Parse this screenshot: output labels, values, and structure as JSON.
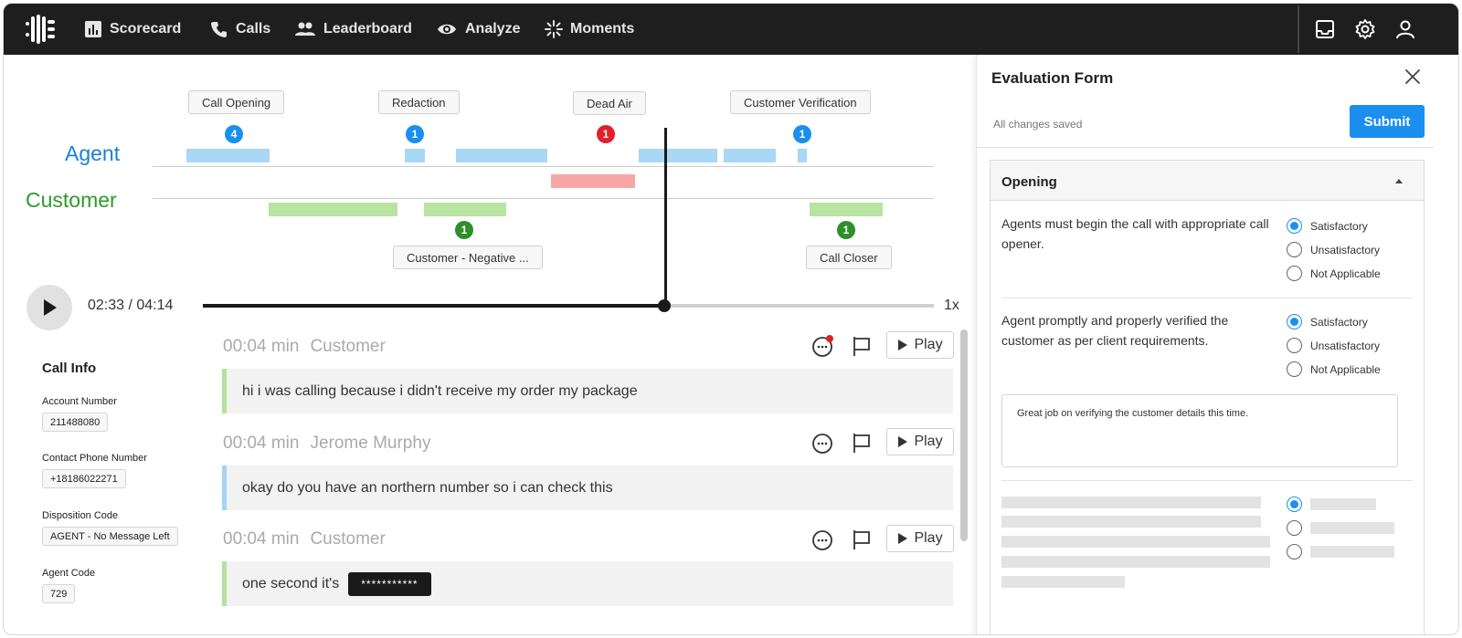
{
  "nav": {
    "items": [
      {
        "label": "Scorecard",
        "icon": "bar-chart-icon"
      },
      {
        "label": "Calls",
        "icon": "phone-icon"
      },
      {
        "label": "Leaderboard",
        "icon": "people-icon"
      },
      {
        "label": "Analyze",
        "icon": "eye-icon"
      },
      {
        "label": "Moments",
        "icon": "sparkle-icon"
      }
    ],
    "right_icons": [
      "inbox-icon",
      "gear-icon",
      "user-icon"
    ]
  },
  "timeline": {
    "agent_label": "Agent",
    "customer_label": "Customer",
    "agent_color": "#1a7fd4",
    "customer_color": "#2f9a2a",
    "tags": [
      {
        "label": "Call Opening",
        "count": "4",
        "color": "#1a8ff0"
      },
      {
        "label": "Redaction",
        "count": "1",
        "color": "#1a8ff0"
      },
      {
        "label": "Dead Air",
        "count": "1",
        "color": "#e0202a"
      },
      {
        "label": "Customer Verification",
        "count": "1",
        "color": "#1a8ff0"
      },
      {
        "label": "Customer - Negative ...",
        "count": "1",
        "color": "#2f8f2a"
      },
      {
        "label": "Call Closer",
        "count": "1",
        "color": "#2f8f2a"
      }
    ]
  },
  "player": {
    "time": "02:33 / 04:14",
    "speed": "1x",
    "progress_percent": 63
  },
  "call_info": {
    "title": "Call Info",
    "fields": [
      {
        "label": "Account Number",
        "value": "211488080"
      },
      {
        "label": "Contact Phone Number",
        "value": "+18186022271"
      },
      {
        "label": "Disposition Code",
        "value": "AGENT - No Message Left"
      },
      {
        "label": "Agent Code",
        "value": "729"
      }
    ]
  },
  "transcript": {
    "play_label": "Play",
    "entries": [
      {
        "time": "00:04 min",
        "speaker": "Customer",
        "text": "hi i was calling because i didn't receive my order my package",
        "redacted": ""
      },
      {
        "time": "00:04 min",
        "speaker": "Jerome Murphy",
        "text": "okay do you have an northern number so i can check this",
        "redacted": ""
      },
      {
        "time": "00:04 min",
        "speaker": "Customer",
        "text": "one second it's",
        "redacted": "***********"
      }
    ]
  },
  "evaluation": {
    "title": "Evaluation Form",
    "saved_status": "All changes saved",
    "submit_label": "Submit",
    "section_title": "Opening",
    "questions": [
      {
        "text": "Agents must begin the call with appropriate call opener.",
        "options": [
          "Satisfactory",
          "Unsatisfactory",
          "Not Applicable"
        ],
        "selected": "Satisfactory"
      },
      {
        "text": "Agent promptly and properly verified the customer as per client requirements.",
        "options": [
          "Satisfactory",
          "Unsatisfactory",
          "Not Applicable"
        ],
        "selected": "Satisfactory",
        "comment": "Great job on verifying the customer details this time."
      }
    ],
    "accent": "#1a8ff0"
  }
}
